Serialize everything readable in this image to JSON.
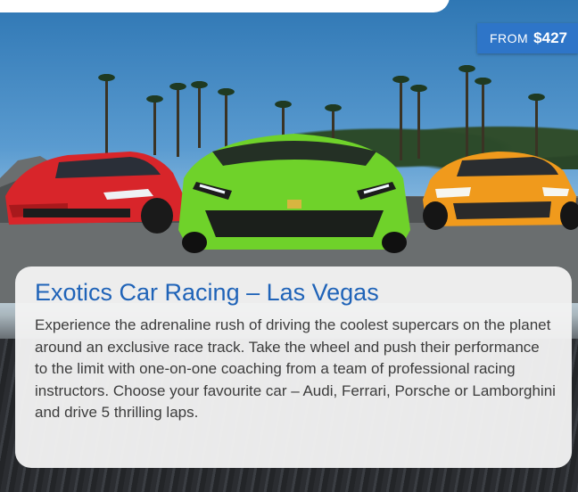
{
  "listing": {
    "price_from_label": "FROM",
    "price_value": "$427",
    "title": "Exotics Car Racing – Las Vegas",
    "description": "Experience the adrenaline rush of driving the coolest supercars on the planet around an exclusive race track. Take the wheel and push their performance to the limit with one-on-one coaching from a team of professional racing instructors. Choose your favourite car – Audi, Ferrari, Porsche or Lamborghini and drive 5 thrilling laps."
  },
  "image": {
    "subject": "three supercars on a race track with palm trees",
    "cars": [
      "red-ferrari",
      "green-lamborghini",
      "orange-mclaren"
    ]
  },
  "colors": {
    "accent": "#2e75c8",
    "title": "#1f63b8",
    "card_bg": "#f2f2f3",
    "body_text": "#3c3c3c"
  }
}
